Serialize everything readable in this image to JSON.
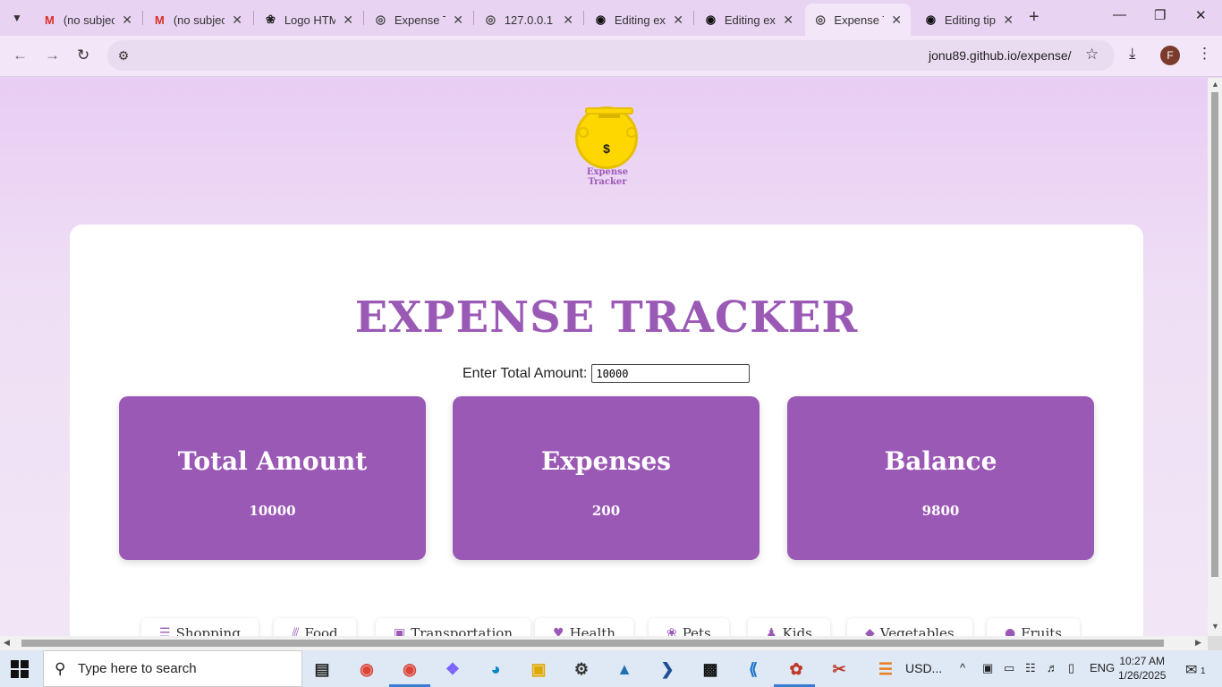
{
  "browser": {
    "tabs": [
      {
        "title": "(no subject)",
        "icon": "gmail-icon",
        "glyph": "M",
        "color": "#d93025"
      },
      {
        "title": "(no subject)",
        "icon": "gmail-icon",
        "glyph": "M",
        "color": "#d93025"
      },
      {
        "title": "Logo HTML",
        "icon": "openai-icon",
        "glyph": "❀",
        "color": "#222"
      },
      {
        "title": "Expense Tracker",
        "icon": "globe-icon",
        "glyph": "◎",
        "color": "#444"
      },
      {
        "title": "127.0.0.1",
        "icon": "globe-icon",
        "glyph": "◎",
        "color": "#444"
      },
      {
        "title": "Editing expense",
        "icon": "github-icon",
        "glyph": "◉",
        "color": "#111"
      },
      {
        "title": "Editing expense",
        "icon": "github-icon",
        "glyph": "◉",
        "color": "#111"
      },
      {
        "title": "Expense Tracker",
        "icon": "globe-icon",
        "glyph": "◎",
        "color": "#444"
      },
      {
        "title": "Editing tips",
        "icon": "github-icon",
        "glyph": "◉",
        "color": "#111"
      }
    ],
    "active_tab": 7,
    "url": "jonu89.github.io/expense/"
  },
  "logo": {
    "symbol": "$",
    "caption": "Expense Tracker"
  },
  "app": {
    "title": "EXPENSE TRACKER",
    "amount_label": "Enter Total Amount:",
    "amount_value": "10000",
    "cards": [
      {
        "heading": "Total Amount",
        "value": "10000"
      },
      {
        "heading": "Expenses",
        "value": "200"
      },
      {
        "heading": "Balance",
        "value": "9800"
      }
    ],
    "categories": [
      {
        "label": "Shopping",
        "icon": "cart-icon",
        "glyph": "☰"
      },
      {
        "label": "Food",
        "icon": "utensils-icon",
        "glyph": "⫻"
      },
      {
        "label": "Transportation",
        "icon": "car-icon",
        "glyph": "▣"
      },
      {
        "label": "Health",
        "icon": "heart-icon",
        "glyph": "♥"
      },
      {
        "label": "Pets",
        "icon": "paw-icon",
        "glyph": "❀"
      },
      {
        "label": "Kids",
        "icon": "child-icon",
        "glyph": "♟"
      },
      {
        "label": "Vegetables",
        "icon": "carrot-icon",
        "glyph": "◆"
      },
      {
        "label": "Fruits",
        "icon": "apple-icon",
        "glyph": "●"
      }
    ],
    "accent": "#9b59b6"
  },
  "taskbar": {
    "search_placeholder": "Type here to search",
    "weather": "USD...",
    "language": "ENG",
    "time": "10:27 AM",
    "date": "1/26/2025",
    "notifications": "1"
  }
}
